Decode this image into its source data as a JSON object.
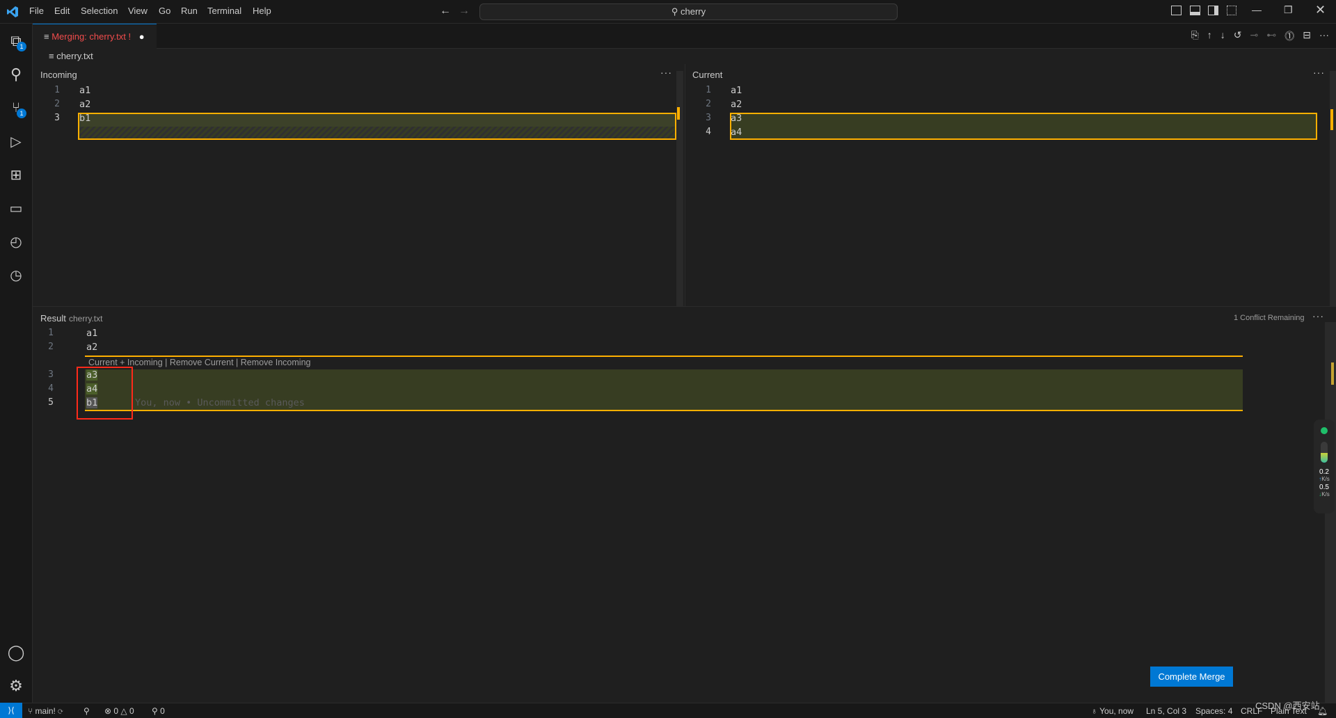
{
  "menu": [
    "File",
    "Edit",
    "Selection",
    "View",
    "Go",
    "Run",
    "Terminal",
    "Help"
  ],
  "search": {
    "value": "cherry"
  },
  "tab": {
    "title": "Merging: cherry.txt",
    "modified_marker": "!"
  },
  "breadcrumb": "cherry.txt",
  "activity_badges": {
    "explorer": "1",
    "source_control": "1"
  },
  "incoming": {
    "title": "Incoming",
    "lines": [
      {
        "n": "1",
        "t": "a1"
      },
      {
        "n": "2",
        "t": "a2"
      },
      {
        "n": "3",
        "t": "b1"
      }
    ]
  },
  "current": {
    "title": "Current",
    "lines": [
      {
        "n": "1",
        "t": "a1"
      },
      {
        "n": "2",
        "t": "a2"
      },
      {
        "n": "3",
        "t": "a3"
      },
      {
        "n": "4",
        "t": "a4"
      }
    ]
  },
  "result": {
    "title": "Result",
    "file": "cherry.txt",
    "conflicts": "1 Conflict Remaining",
    "codelens": "Current + Incoming | Remove Current | Remove Incoming",
    "lines": [
      {
        "n": "1",
        "t": "a1"
      },
      {
        "n": "2",
        "t": "a2"
      },
      {
        "n": "3",
        "t": "a3"
      },
      {
        "n": "4",
        "t": "a4"
      },
      {
        "n": "5",
        "t": "b1"
      }
    ],
    "blame": "You, now • Uncommitted changes"
  },
  "complete_merge": "Complete Merge",
  "network": {
    "up": "0.2",
    "down": "0.5",
    "unit": "K/s"
  },
  "status": {
    "branch": "main!",
    "errors": "0",
    "warnings": "0",
    "ports": "0",
    "blame": "You, now",
    "position": "Ln 5, Col 3",
    "spaces": "Spaces: 4",
    "eol": "CRLF",
    "language": "Plain Text"
  },
  "watermark": "CSDN @西安站",
  "colors": {
    "accent": "#0078d4",
    "conflict": "#ffb000",
    "tab_error": "#f14c4c",
    "highlight": "#ff2a1a"
  }
}
